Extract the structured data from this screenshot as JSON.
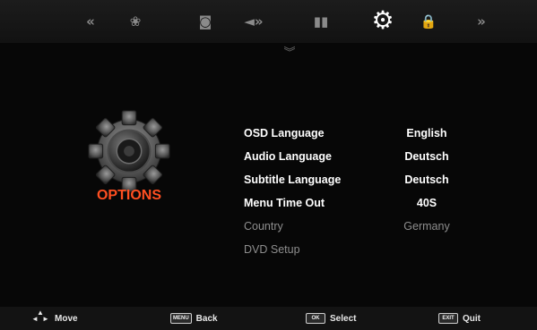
{
  "top_nav": {
    "icons": [
      {
        "name": "prev-icon",
        "glyph": "«"
      },
      {
        "name": "picture-icon",
        "glyph": "❀"
      },
      {
        "name": "channel-icon",
        "glyph": "◙"
      },
      {
        "name": "sound-icon",
        "glyph": "◄»"
      },
      {
        "name": "time-icon",
        "glyph": "▮▮"
      },
      {
        "name": "options-gear-icon",
        "glyph": "⚙"
      },
      {
        "name": "lock-icon",
        "glyph": "🔒"
      },
      {
        "name": "next-icon",
        "glyph": "»"
      }
    ],
    "scroll_down_glyph": "︾"
  },
  "section": {
    "title": "OPTIONS"
  },
  "menu": {
    "items": [
      {
        "label": "OSD Language",
        "value": "English",
        "enabled": true
      },
      {
        "label": "Audio Language",
        "value": "Deutsch",
        "enabled": true
      },
      {
        "label": "Subtitle Language",
        "value": "Deutsch",
        "enabled": true
      },
      {
        "label": "Menu Time Out",
        "value": "40S",
        "enabled": true
      },
      {
        "label": "Country",
        "value": "Germany",
        "enabled": false
      },
      {
        "label": "DVD Setup",
        "value": "",
        "enabled": false
      }
    ]
  },
  "footer": {
    "move_label": "Move",
    "back_key": "MENU",
    "back_label": "Back",
    "select_key": "OK",
    "select_label": "Select",
    "quit_key": "EXIT",
    "quit_label": "Quit"
  },
  "colors": {
    "accent": "#ff4f21",
    "disabled_text": "#8e8e8e",
    "background": "#070707"
  }
}
